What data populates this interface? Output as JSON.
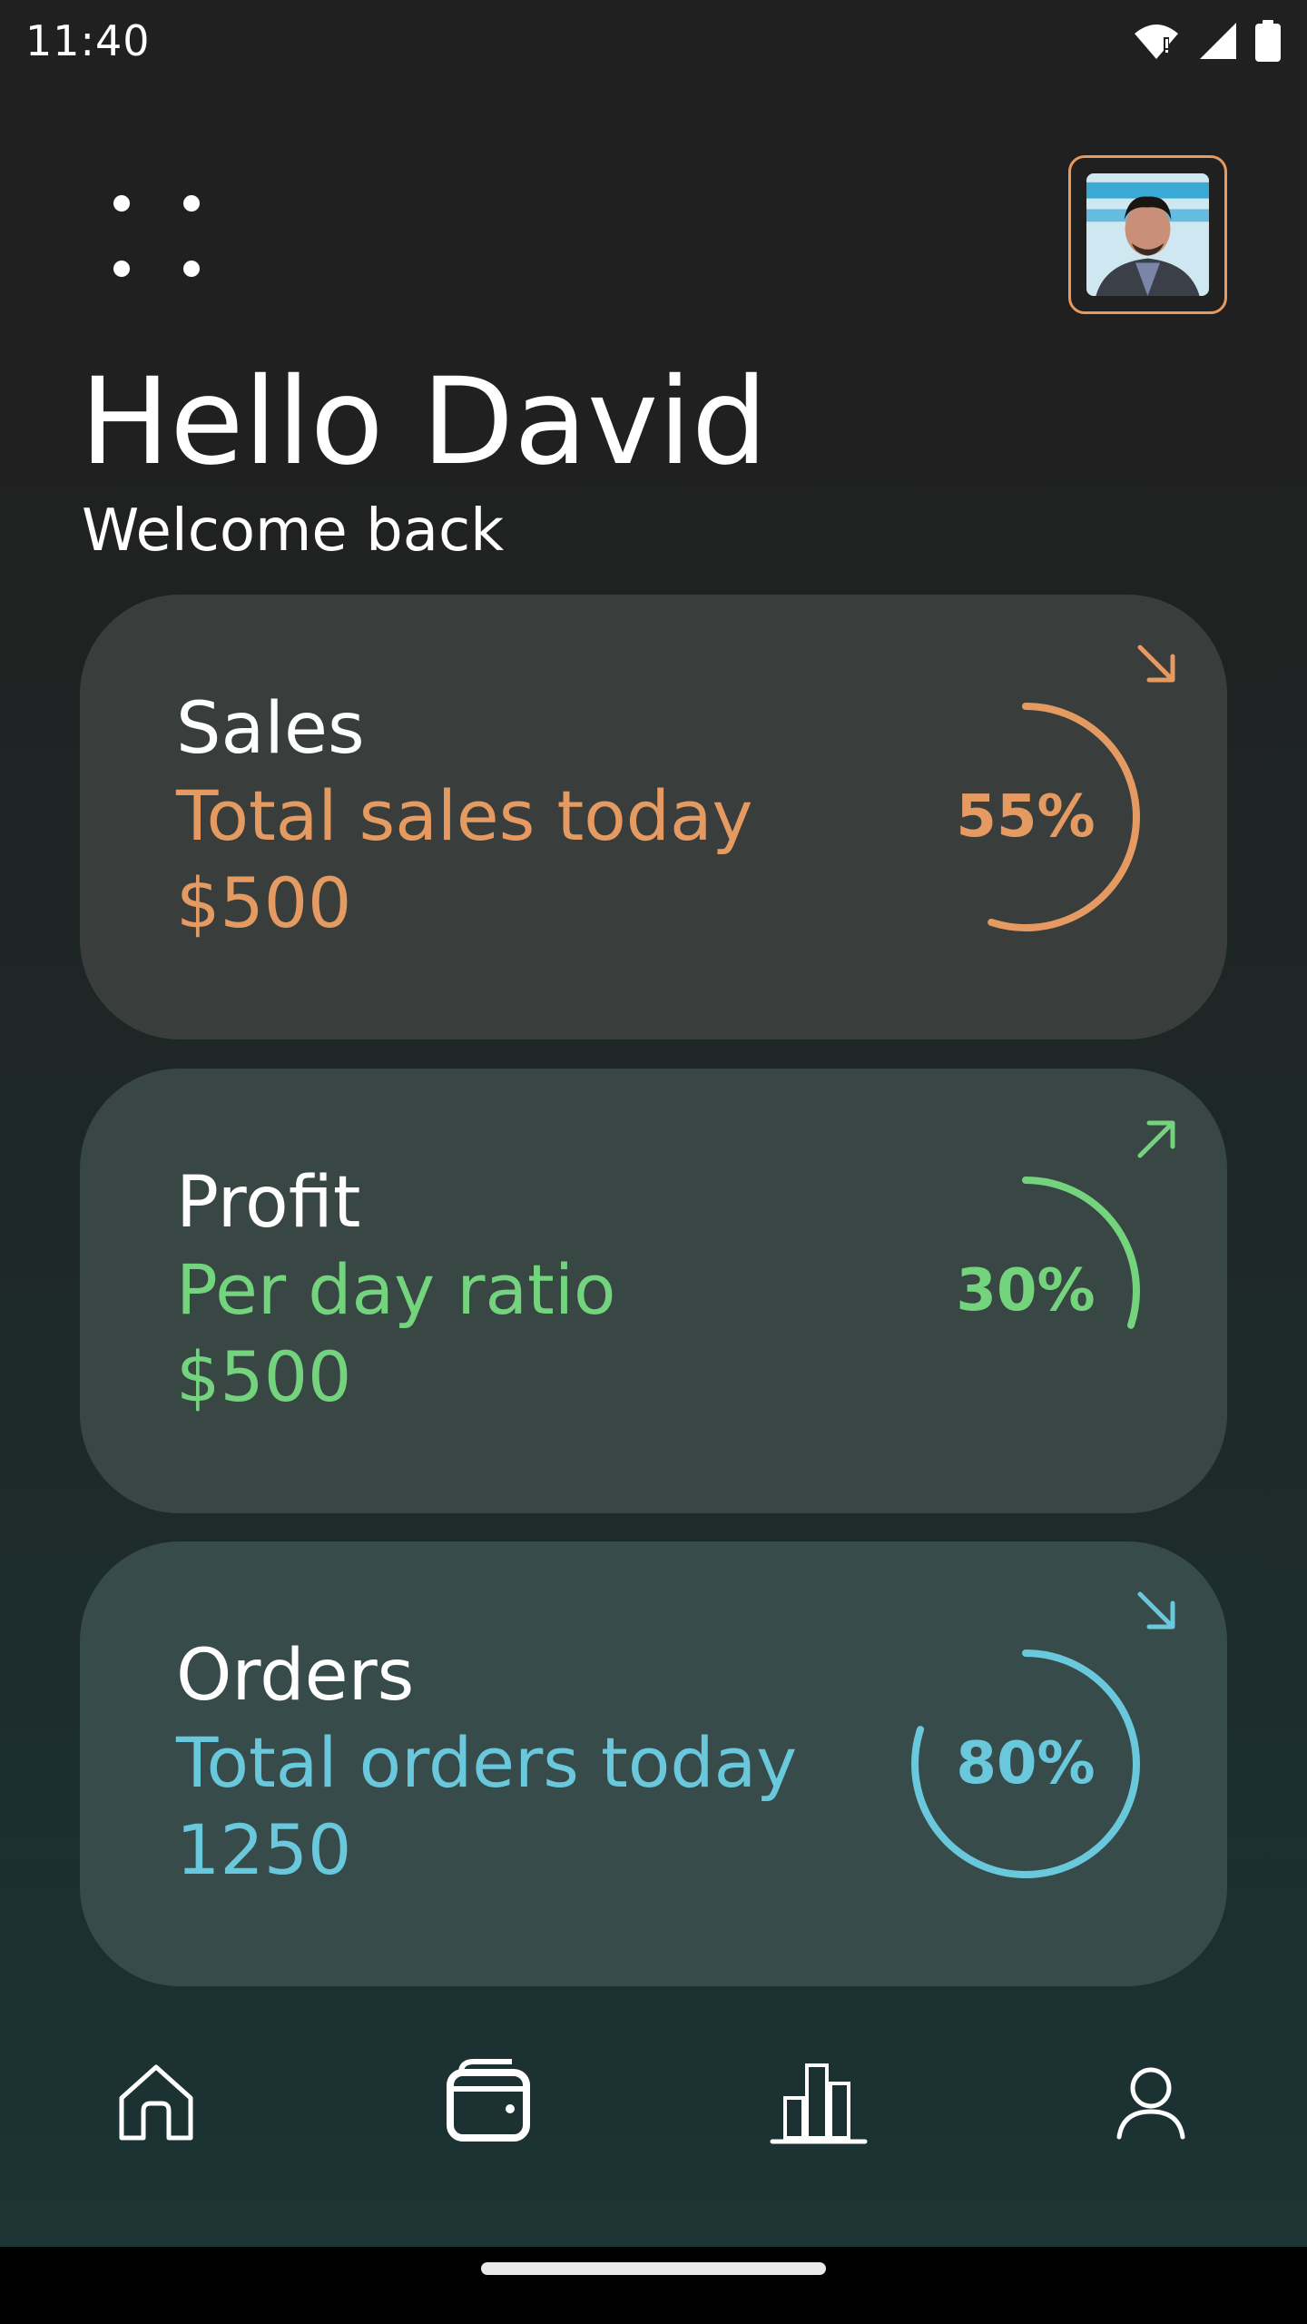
{
  "status_bar": {
    "time": "11:40",
    "icons": [
      "wifi-alert-icon",
      "signal-icon",
      "battery-icon"
    ]
  },
  "header": {
    "menu_icon": "dots-grid-icon",
    "avatar_alt": "avatar"
  },
  "greeting": {
    "title": "Hello David",
    "subtitle": "Welcome back"
  },
  "cards": [
    {
      "title": "Sales",
      "subtitle": "Total sales today",
      "value": "$500",
      "percent_label": "55%",
      "percent": 55,
      "arrow": "arrow-down-right-icon",
      "color": "#e59a62"
    },
    {
      "title": "Profit",
      "subtitle": "Per day ratio",
      "value": "$500",
      "percent_label": "30%",
      "percent": 30,
      "arrow": "arrow-up-right-icon",
      "color": "#74d47e"
    },
    {
      "title": "Orders",
      "subtitle": "Total orders today",
      "value": "1250",
      "percent_label": "80%",
      "percent": 80,
      "arrow": "arrow-down-right-icon",
      "color": "#6ac8dd"
    }
  ],
  "bottom_nav": {
    "items": [
      "home-icon",
      "wallet-icon",
      "bar-chart-icon",
      "user-icon"
    ]
  },
  "colors": {
    "accent_orange": "#e59a62",
    "accent_green": "#74d47e",
    "accent_blue": "#6ac8dd"
  }
}
